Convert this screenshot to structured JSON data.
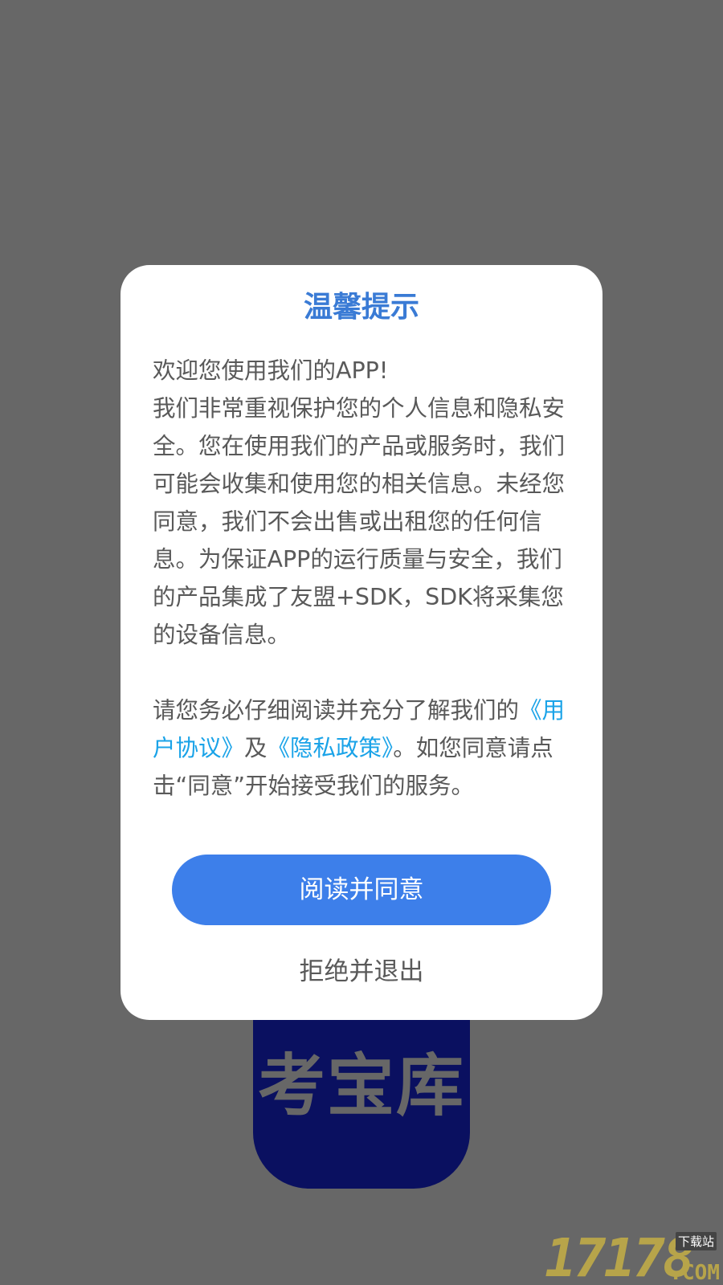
{
  "splash": {
    "logo_text": "考宝库",
    "logo_color": "#0a1060",
    "background_color": "#676767"
  },
  "dialog": {
    "title": "温馨提示",
    "intro_lines": [
      "欢迎您使用我们的APP!",
      "我们非常重视保护您的个人信息和隐私安全。您在使用我们的产品或服务时，我们可能会收集和使用您的相关信息。未经您同意，我们不会出售或出租您的任何信息。为保证APP的运行质量与安全，我们的产品集成了友盟+SDK，SDK将采集您的设备信息。"
    ],
    "agreement": {
      "prefix": "请您务必仔细阅读并充分了解我们的",
      "user_agreement_link": "《用户协议》",
      "conjunction": "及",
      "privacy_policy_link": "《隐私政策》",
      "suffix": "。如您同意请点击“同意”开始接受我们的服务。"
    },
    "agree_button_label": "阅读并同意",
    "reject_button_label": "拒绝并退出",
    "accent_color": "#3d7fea",
    "link_color": "#1aa3e8"
  },
  "watermark": {
    "number": "17178",
    "site_label": "下载站",
    "domain": ".COM"
  }
}
